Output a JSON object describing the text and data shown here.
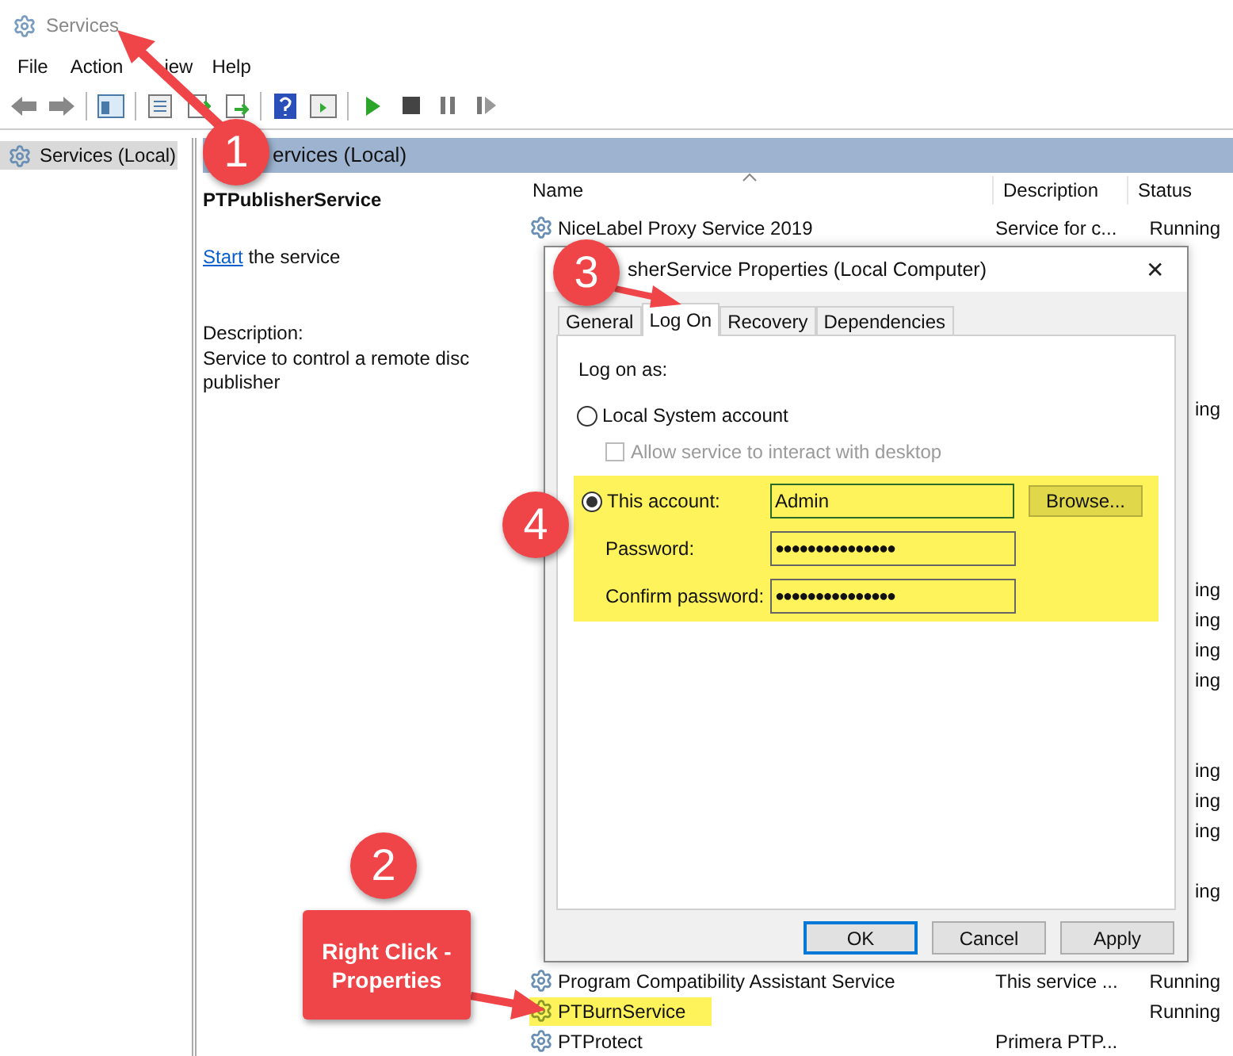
{
  "window": {
    "title": "Services"
  },
  "menu": [
    "File",
    "Action",
    "iew",
    "Help"
  ],
  "tree": [
    {
      "label": "Services (Local)",
      "selected": true
    }
  ],
  "pane_header": "ervices (Local)",
  "detail": {
    "service_name": "PTPublisherService",
    "start_link": "Start",
    "start_rest": "the service",
    "description_label": "Description:",
    "description": "Service to control a remote disc publisher"
  },
  "list": {
    "columns": [
      "Name",
      "Description",
      "Status"
    ],
    "rows": [
      {
        "name": "NiceLabel Proxy Service 2019",
        "description": "Service for c...",
        "status": "Running",
        "highlighted": false
      },
      null,
      null,
      null,
      null,
      null,
      {
        "status": "ing"
      },
      null,
      null,
      null,
      null,
      null,
      {
        "status": "ing"
      },
      {
        "status": "ing"
      },
      {
        "status": "ing"
      },
      {
        "status": "ing"
      },
      null,
      null,
      {
        "status": "ing"
      },
      {
        "status": "ing"
      },
      {
        "status": "ing"
      },
      null,
      {
        "status": "ing"
      },
      null,
      null,
      {
        "name": "Program Compatibility Assistant Service",
        "description": "This service ...",
        "status": "Running",
        "highlighted": false
      },
      {
        "name": "PTBurnService",
        "description": "",
        "status": "Running",
        "highlighted": true
      },
      {
        "name": "PTProtect",
        "description": "Primera PTP...",
        "status": "",
        "highlighted": false
      }
    ]
  },
  "dialog": {
    "title": "sherService Properties (Local Computer)",
    "close": "✕",
    "tabs": [
      {
        "label": "General",
        "selected": false
      },
      {
        "label": "Log On",
        "selected": true
      },
      {
        "label": "Recovery",
        "selected": false
      },
      {
        "label": "Dependencies",
        "selected": false
      }
    ],
    "log_on_label": "Log on as:",
    "local_system": {
      "label": "Local System account",
      "selected": false
    },
    "allow_interact": {
      "label": "Allow service to interact with desktop",
      "checked": false,
      "disabled": true
    },
    "this_account": {
      "label": "This account:",
      "selected": true,
      "value": "Admin",
      "highlighted": true
    },
    "browse": "Browse...",
    "password": {
      "label": "Password:",
      "value": "●●●●●●●●●●●●●●●"
    },
    "confirm_password": {
      "label": "Confirm password:",
      "value": "●●●●●●●●●●●●●●●"
    },
    "buttons": [
      {
        "label": "OK",
        "default": true
      },
      {
        "label": "Cancel",
        "default": false
      },
      {
        "label": "Apply",
        "default": false
      }
    ]
  },
  "annotations": {
    "markers": [
      "1",
      "2",
      "3",
      "4"
    ],
    "callout": "Right Click - Properties"
  }
}
